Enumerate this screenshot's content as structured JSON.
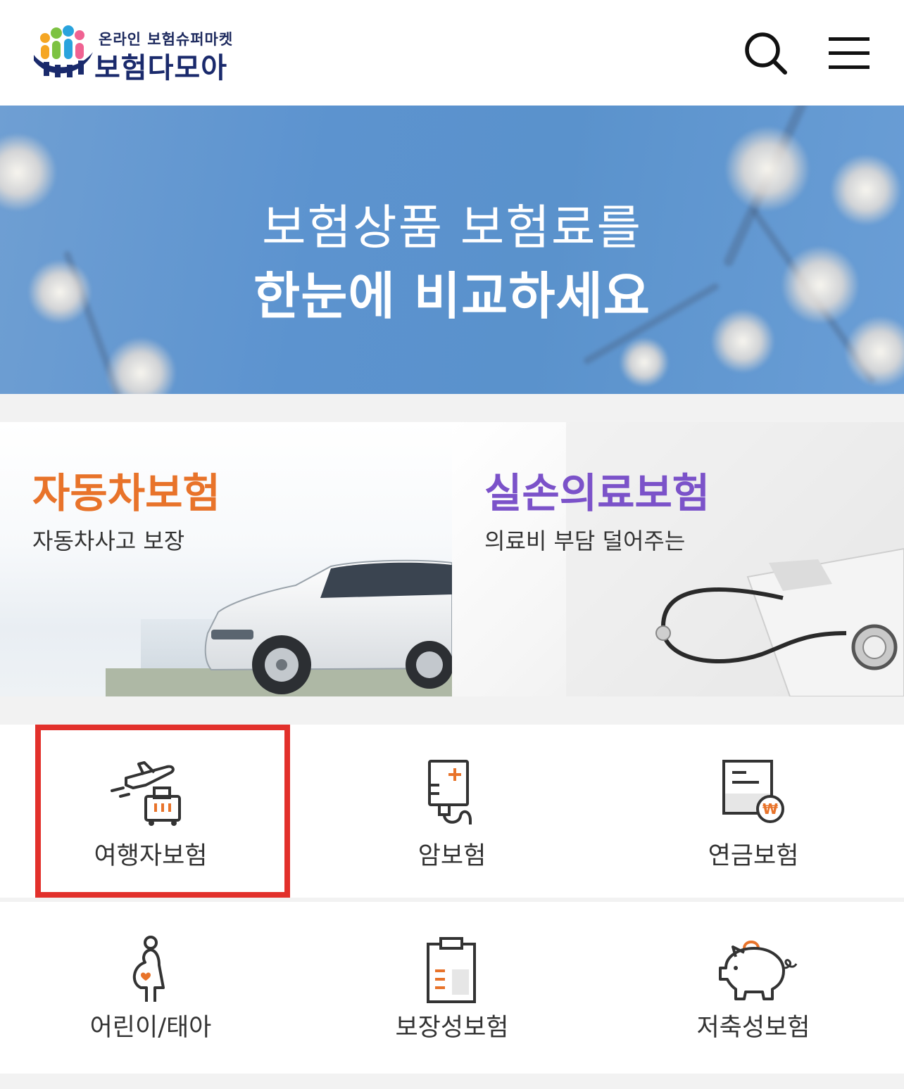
{
  "header": {
    "logo_subtitle": "온라인 보험슈퍼마켓",
    "logo_title": "보험다모아",
    "search_icon": "search-icon",
    "menu_icon": "hamburger-menu-icon"
  },
  "hero": {
    "line1": "보험상품 보험료를",
    "line2": "한눈에 비교하세요"
  },
  "cards": [
    {
      "title": "자동차보험",
      "subtitle": "자동차사고 보장",
      "title_color": "#e8732a",
      "icon": "car-photo"
    },
    {
      "title": "실손의료보험",
      "subtitle": "의료비 부담 덜어주는",
      "title_color": "#7b52c9",
      "icon": "stethoscope-photo"
    }
  ],
  "grid": [
    {
      "label": "여행자보험",
      "icon": "airplane-luggage-icon",
      "highlighted": true
    },
    {
      "label": "암보험",
      "icon": "iv-bag-icon"
    },
    {
      "label": "연금보험",
      "icon": "pension-document-icon"
    },
    {
      "label": "어린이/태아",
      "icon": "pregnant-woman-icon"
    },
    {
      "label": "보장성보험",
      "icon": "clipboard-icon"
    },
    {
      "label": "저축성보험",
      "icon": "piggy-bank-icon"
    }
  ],
  "colors": {
    "accent_orange": "#e8732a",
    "accent_purple": "#7b52c9",
    "highlight_red": "#e2302b",
    "brand_navy": "#1a2a6c"
  }
}
